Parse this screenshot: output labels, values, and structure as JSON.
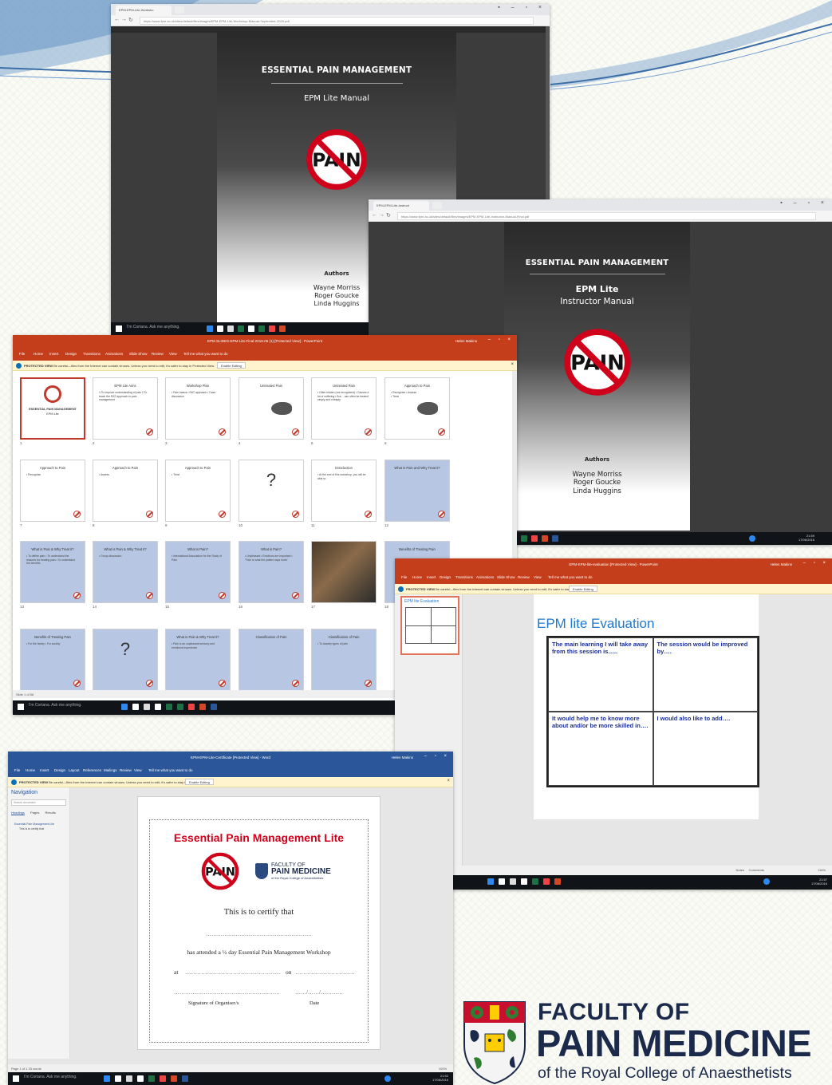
{
  "browser1": {
    "tab_title": "EPM-EPM-Lite-Worksho",
    "url": "https://www.fpm.ac.uk/sites/default/files/images/EPM-EPM-Lite-Workshop-Manual-September-2016.pdf",
    "page": {
      "title": "ESSENTIAL PAIN MANAGEMENT",
      "subtitle": "EPM Lite Manual",
      "sign_text": "PAIN",
      "authors_heading": "Authors",
      "authors": [
        "Wayne Morriss",
        "Roger Goucke",
        "Linda Huggins"
      ]
    },
    "taskbar_search": "I'm Cortana. Ask me anything."
  },
  "browser2": {
    "tab_title": "EPM-EPM-Lite-Instruct",
    "url": "https://www.fpm.ac.uk/sites/default/files/images/EPM-EPM-Lite-Instructor-Manual-Final.pdf",
    "page": {
      "title": "ESSENTIAL PAIN MANAGEMENT",
      "subtitle_bold": "EPM Lite",
      "subtitle": "Instructor Manual",
      "sign_text": "PAIN",
      "authors_heading": "Authors",
      "authors": [
        "Wayne Morriss",
        "Roger Goucke",
        "Linda Huggins"
      ]
    },
    "clock": "21:59",
    "date": "17/06/2016"
  },
  "powerpoint": {
    "title": "EPM SLIDES-EPM-Lite-Final-2016-06 (1) [Protected View] - PowerPoint",
    "user": "Helen Makins",
    "ribbon_tabs": [
      "File",
      "Home",
      "Insert",
      "Design",
      "Transitions",
      "Animations",
      "Slide Show",
      "Review",
      "View",
      "Tell me what you want to do"
    ],
    "protected_label": "PROTECTED VIEW",
    "protected_text": "Be careful—files from the Internet can contain viruses. Unless you need to edit, it's safer to stay in Protected View.",
    "enable_editing": "Enable Editing",
    "status": "Slide 1 of 56",
    "taskbar_search": "I'm Cortana. Ask me anything.",
    "slides": [
      {
        "num": "1",
        "title": "ESSENTIAL PAIN MANAGEMENT",
        "body": "EPM Lite",
        "kind": "cover"
      },
      {
        "num": "2",
        "title": "EPM Lite Aims",
        "body": "1.To improve understanding of pain 2.To teach the RAT approach to pain management"
      },
      {
        "num": "3",
        "title": "Workshop Plan",
        "body": "• Pain basics • RAT approach • Case discussion"
      },
      {
        "num": "4",
        "title": "Untreated Pain",
        "body": "",
        "kind": "rat"
      },
      {
        "num": "5",
        "title": "Untreated Pain",
        "body": "• Often hidden (not recognised) • Causes a lot of suffering • But… can often be treated simply and cheaply"
      },
      {
        "num": "6",
        "title": "Approach to Pain",
        "body": "• Recognise • Assess • Treat",
        "kind": "rat"
      },
      {
        "num": "7",
        "title": "Approach to Pain",
        "body": "• Recognise"
      },
      {
        "num": "8",
        "title": "Approach to Pain",
        "body": "• Assess"
      },
      {
        "num": "9",
        "title": "Approach to Pain",
        "body": "• Treat"
      },
      {
        "num": "10",
        "title": "",
        "body": "?",
        "kind": "question"
      },
      {
        "num": "11",
        "title": "Introduction",
        "body": "• At the end of this workshop, you will be able to:"
      },
      {
        "num": "12",
        "title": "What is Pain and Why Treat it?",
        "body": "",
        "kind": "blue"
      },
      {
        "num": "13",
        "title": "What is Pain & Why Treat it?",
        "body": "• To define pain • To understand the reasons for treating pain • To understand the benefits",
        "kind": "blue"
      },
      {
        "num": "14",
        "title": "What is Pain & Why Treat it?",
        "body": "• Group discussion",
        "kind": "blue"
      },
      {
        "num": "15",
        "title": "What is Pain?",
        "body": "• International Association for the Study of Pain",
        "kind": "blue"
      },
      {
        "num": "16",
        "title": "What is Pain?",
        "body": "• Unpleasant • Emotions are important • \"Pain is what the patient says hurts\"",
        "kind": "blue"
      },
      {
        "num": "17",
        "title": "",
        "body": "",
        "kind": "photo"
      },
      {
        "num": "18",
        "title": "Benefits of Treating Pain",
        "body": "",
        "kind": "blue"
      },
      {
        "num": "19",
        "title": "Benefits of Treating Pain",
        "body": "• For the family • For society",
        "kind": "blue"
      },
      {
        "num": "20",
        "title": "",
        "body": "?",
        "kind": "question-blue"
      },
      {
        "num": "21",
        "title": "What is Pain & Why Treat it?",
        "body": "• Pain is an unpleasant sensory and emotional experience",
        "kind": "blue"
      },
      {
        "num": "22",
        "title": "Classification of Pain",
        "body": "",
        "kind": "blue"
      },
      {
        "num": "23",
        "title": "Classification of Pain",
        "body": "• To classify types of pain",
        "kind": "blue"
      }
    ]
  },
  "evaluation": {
    "title": "EPM lite Evaluation",
    "window_title": "EPM-EPM-lite-evaluation [Protected View] - PowerPoint",
    "user": "Helen Makins",
    "thumb_title": "EPM lite Evaluation",
    "cells": [
      "The main learning I will take away from this session is…..",
      "The session would be improved by….",
      "It would help me to know more about and/or be more skilled in….",
      "I would also like to add…."
    ],
    "status_notes": "Notes",
    "status_comments": "Comments",
    "zoom": "116%",
    "clock": "21:57",
    "date": "17/06/2016"
  },
  "word": {
    "title": "EPM-EPM-Lite-Certificate [Protected View] - Word",
    "user": "Helen Makins",
    "ribbon_tabs": [
      "File",
      "Home",
      "Insert",
      "Design",
      "Layout",
      "References",
      "Mailings",
      "Review",
      "View",
      "Tell me what you want to do"
    ],
    "protected_label": "PROTECTED VIEW",
    "protected_text": "Be careful—files from the Internet can contain viruses. Unless you need to edit, it's safer to stay in Protected View.",
    "enable_editing": "Enable Editing",
    "nav": {
      "title": "Navigation",
      "search_placeholder": "Search document",
      "tabs": [
        "Headings",
        "Pages",
        "Results"
      ],
      "items": [
        "Essential Pain Management Lite",
        "This is to certify that"
      ]
    },
    "certificate": {
      "title": "Essential Pain Management Lite",
      "sign_text": "PAIN",
      "faculty_line1": "FACULTY OF",
      "faculty_line2": "PAIN MEDICINE",
      "faculty_line3": "of the Royal College of Anaesthetists",
      "certify": "This is to certify that",
      "dots1": "…………………………………………………",
      "attended": "has attended a ½ day Essential Pain Management Workshop",
      "at_label": "at",
      "at_dots": "…………………………………………",
      "on_label": "on",
      "on_dots": "…………………………",
      "sig_dots": "…………………………………………………",
      "date_dots": "……/……/…………",
      "sig_label": "Signature of Organiser/s",
      "date_label": "Date"
    },
    "status": "Page 1 of 1    33 words",
    "zoom": "100%",
    "taskbar_search": "I'm Cortana. Ask me anything.",
    "clock": "21:52",
    "date": "17/06/2016"
  },
  "logo": {
    "line1": "FACULTY OF",
    "line2": "PAIN MEDICINE",
    "line3": "of the Royal College of Anaesthetists"
  },
  "colors": {
    "powerpoint_orange": "#c43e1c",
    "word_blue": "#2b579a",
    "logo_navy": "#1b2a4a",
    "eval_title_blue": "#1f77d0",
    "pain_red": "#d0021b"
  }
}
